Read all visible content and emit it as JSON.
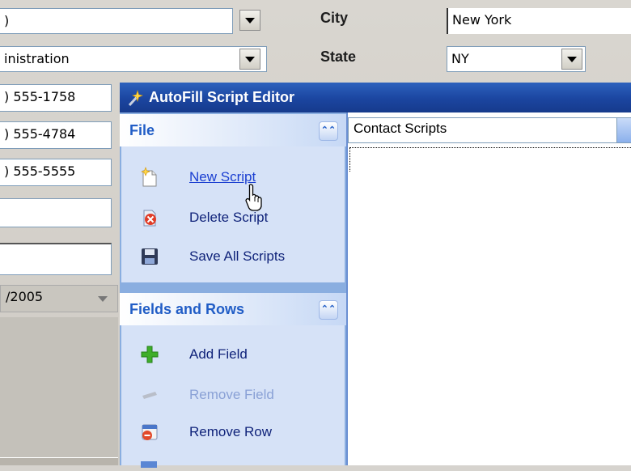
{
  "background_form": {
    "row1_value": ")",
    "row2_value": "inistration",
    "city_label": "City",
    "city_value": "New York",
    "state_label": "State",
    "state_value": "NY",
    "phone1": ") 555-1758",
    "phone2": ") 555-4784",
    "phone3": ") 555-5555",
    "date_value": "/2005"
  },
  "editor": {
    "title": "AutoFill Script Editor",
    "file_group": {
      "header": "File",
      "items": [
        {
          "label": "New Script",
          "icon": "new-script-icon"
        },
        {
          "label": "Delete Script",
          "icon": "delete-script-icon"
        },
        {
          "label": "Save All Scripts",
          "icon": "save-icon"
        }
      ]
    },
    "fields_group": {
      "header": "Fields and Rows",
      "items": [
        {
          "label": "Add Field",
          "icon": "add-field-icon"
        },
        {
          "label": "Remove Field",
          "icon": "remove-field-icon",
          "disabled": true
        },
        {
          "label": "Remove Row",
          "icon": "remove-row-icon"
        }
      ]
    },
    "scripts_combo": "Contact Scripts"
  },
  "colors": {
    "titlebar": "#1b45a0",
    "group_header_text": "#215dc6",
    "link": "#1a3ed1"
  }
}
